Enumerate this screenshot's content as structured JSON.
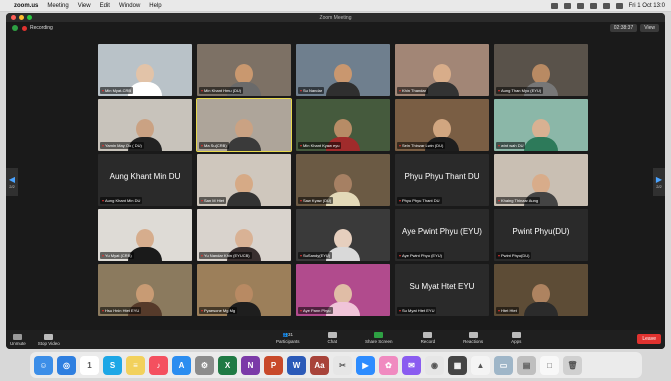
{
  "menubar": {
    "apple": "",
    "app": "zoom.us",
    "items": [
      "Meeting",
      "View",
      "Edit",
      "Window",
      "Help"
    ],
    "clock": "Fri 1 Oct 13:0"
  },
  "window": {
    "title": "Zoom Meeting",
    "recording": "Recording",
    "timer": "02:38:37",
    "view": "View"
  },
  "nav": {
    "prev_page": "2/2",
    "next_page": "2/2"
  },
  "tiles": [
    {
      "name": "Min Myat-CRB",
      "video": true,
      "bg": "#b9c2c8",
      "skin": "#e2c3a8",
      "shirt": "#ffffff"
    },
    {
      "name": "Min Khant Hmu (DU)",
      "video": true,
      "bg": "#7d7165",
      "skin": "#c9986f",
      "shirt": "#6a6a6a"
    },
    {
      "name": "Su Nandar",
      "video": true,
      "bg": "#6f7f8e",
      "skin": "#c9976f",
      "shirt": "#2f2f2f"
    },
    {
      "name": "Khin Thandar",
      "video": true,
      "bg": "#a28676",
      "skin": "#d8ad8a",
      "shirt": "#333333"
    },
    {
      "name": "Aung Than Myo (EYU)",
      "video": true,
      "bg": "#59524a",
      "skin": "#b88a63",
      "shirt": "#777777"
    },
    {
      "name": "Yamin May Oo ( DU)",
      "video": true,
      "bg": "#c8c3bb",
      "skin": "#caa283",
      "shirt": "#222222"
    },
    {
      "name": "Ma Su(CRB)",
      "video": true,
      "bg": "#aea59a",
      "skin": "#caa283",
      "shirt": "#3a3a3a",
      "active": true
    },
    {
      "name": "Min Khant Kyaw eyu",
      "video": true,
      "bg": "#455a3d",
      "skin": "#b78c66",
      "shirt": "#a02b2b"
    },
    {
      "name": "Sein Thinzar Lwin (DU)",
      "video": true,
      "bg": "#7a5e44",
      "skin": "#d1a680",
      "shirt": "#1e1e1e"
    },
    {
      "name": "wint wah DU",
      "video": true,
      "bg": "#8bb7a8",
      "skin": "#d8b192",
      "shirt": "#2d7a5a"
    },
    {
      "name": "Aung Khant Min DU",
      "video": false,
      "bigname": "Aung Khant Min DU"
    },
    {
      "name": "San M Htet",
      "video": true,
      "bg": "#cfc7bd",
      "skin": "#d6aa86",
      "shirt": "#333333"
    },
    {
      "name": "Saw Kyaw (DU)",
      "video": true,
      "bg": "#6b5a44",
      "skin": "#a68063",
      "shirt": "#e3d9b8"
    },
    {
      "name": "Phyu Phyu Thant DU",
      "video": false,
      "bigname": "Phyu Phyu Thant DU"
    },
    {
      "name": "Khaing Thinzar Aung",
      "video": true,
      "bg": "#c9bfb3",
      "skin": "#d8ac8a",
      "shirt": "#444444"
    },
    {
      "name": "Yu Myat (CRB)",
      "video": true,
      "bg": "#dedbd6",
      "skin": "#d6ad8d",
      "shirt": "#1a1a1a"
    },
    {
      "name": "Yu Nandar Khin (EYUCB)",
      "video": true,
      "bg": "#d9d3cd",
      "skin": "#d9b295",
      "shirt": "#3a3030"
    },
    {
      "name": "SuSandy(EYU)",
      "video": true,
      "bg": "#3a3a3a",
      "skin": "#e6cfbe",
      "shirt": "#d9d9d9"
    },
    {
      "name": "Aye Pwint Phyu (EYU)",
      "video": false,
      "bigname": "Aye Pwint Phyu (EYU)"
    },
    {
      "name": "Pwint Phyu(DU)",
      "video": false,
      "bigname": "Pwint Phyu(DU)"
    },
    {
      "name": "Hsu Hnin Htet EYU",
      "video": true,
      "bg": "#8b7a5e",
      "skin": "#c89b74",
      "shirt": "#553a2a"
    },
    {
      "name": "Pyaesone Mg Mg",
      "video": true,
      "bg": "#9c7f5a",
      "skin": "#b88a63",
      "shirt": "#1e1e1e"
    },
    {
      "name": "Aye Pann Phyu",
      "video": true,
      "bg": "#b14b8d",
      "skin": "#e0bda6",
      "shirt": "#f0c4d8"
    },
    {
      "name": "Su Myat Htet EYU",
      "video": false,
      "bigname": "Su Myat Htet EYU"
    },
    {
      "name": "Htet Htet",
      "video": true,
      "bg": "#5d4c36",
      "skin": "#ae8360",
      "shirt": "#2b2b2b"
    }
  ],
  "toolbar": {
    "unmute": "Unmute",
    "stop_video": "Stop Video",
    "participants": "Participants",
    "participants_count": "31",
    "chat": "Chat",
    "share_screen": "Share Screen",
    "record": "Record",
    "reactions": "Reactions",
    "apps": "Apps",
    "leave": "Leave"
  },
  "dock": {
    "icons": [
      {
        "name": "finder-icon",
        "color": "#3c8ee8",
        "glyph": "☺"
      },
      {
        "name": "safari-icon",
        "color": "#2f7fe0",
        "glyph": "◎"
      },
      {
        "name": "calendar-icon",
        "color": "#ffffff",
        "glyph": "1"
      },
      {
        "name": "skype-icon",
        "color": "#1ea7e6",
        "glyph": "S"
      },
      {
        "name": "notes-icon",
        "color": "#f2d15c",
        "glyph": "≡"
      },
      {
        "name": "music-icon",
        "color": "#f4505f",
        "glyph": "♪"
      },
      {
        "name": "app-store-icon",
        "color": "#2b8df0",
        "glyph": "A"
      },
      {
        "name": "system-preferences-icon",
        "color": "#8c8c8c",
        "glyph": "⚙"
      },
      {
        "name": "excel-icon",
        "color": "#1f7a44",
        "glyph": "X"
      },
      {
        "name": "onenote-icon",
        "color": "#7b3aa8",
        "glyph": "N"
      },
      {
        "name": "powerpoint-icon",
        "color": "#c8492a",
        "glyph": "P"
      },
      {
        "name": "word-icon",
        "color": "#2b5ab8",
        "glyph": "W"
      },
      {
        "name": "dictionary-icon",
        "color": "#a8433a",
        "glyph": "Aa"
      },
      {
        "name": "preview-icon",
        "color": "#e6e6e6",
        "glyph": "✂"
      },
      {
        "name": "zoom-icon",
        "color": "#2d8cff",
        "glyph": "▶"
      },
      {
        "name": "photos-icon",
        "color": "#f08ac0",
        "glyph": "✿"
      },
      {
        "name": "messenger-icon",
        "color": "#8a5cf0",
        "glyph": "✉"
      },
      {
        "name": "chrome-icon",
        "color": "#e6e6e6",
        "glyph": "◉"
      },
      {
        "name": "calculator-icon",
        "color": "#444444",
        "glyph": "▦"
      },
      {
        "name": "drive-icon",
        "color": "#f4f4f4",
        "glyph": "▲"
      },
      {
        "name": "finder-window-icon",
        "color": "#9fb6c8",
        "glyph": "▭"
      },
      {
        "name": "printer-icon",
        "color": "#bfbfbf",
        "glyph": "▤"
      },
      {
        "name": "document-icon",
        "color": "#f8f8f8",
        "glyph": "□"
      },
      {
        "name": "trash-icon",
        "color": "#d0d0d0",
        "glyph": "🗑"
      }
    ]
  }
}
